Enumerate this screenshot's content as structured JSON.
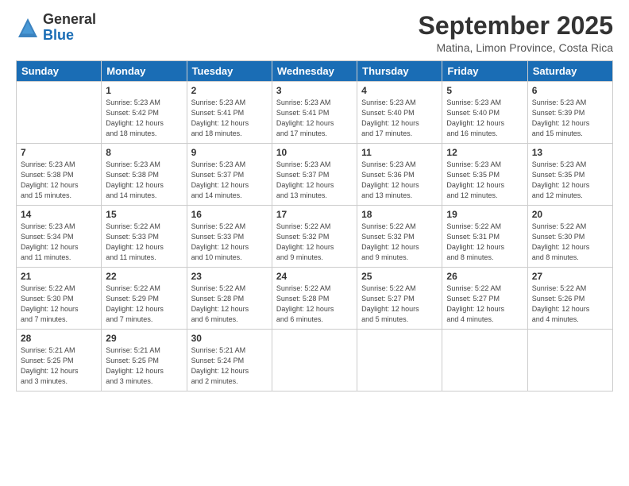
{
  "header": {
    "logo_general": "General",
    "logo_blue": "Blue",
    "month": "September 2025",
    "location": "Matina, Limon Province, Costa Rica"
  },
  "weekdays": [
    "Sunday",
    "Monday",
    "Tuesday",
    "Wednesday",
    "Thursday",
    "Friday",
    "Saturday"
  ],
  "weeks": [
    [
      {
        "day": "",
        "info": ""
      },
      {
        "day": "1",
        "info": "Sunrise: 5:23 AM\nSunset: 5:42 PM\nDaylight: 12 hours\nand 18 minutes."
      },
      {
        "day": "2",
        "info": "Sunrise: 5:23 AM\nSunset: 5:41 PM\nDaylight: 12 hours\nand 18 minutes."
      },
      {
        "day": "3",
        "info": "Sunrise: 5:23 AM\nSunset: 5:41 PM\nDaylight: 12 hours\nand 17 minutes."
      },
      {
        "day": "4",
        "info": "Sunrise: 5:23 AM\nSunset: 5:40 PM\nDaylight: 12 hours\nand 17 minutes."
      },
      {
        "day": "5",
        "info": "Sunrise: 5:23 AM\nSunset: 5:40 PM\nDaylight: 12 hours\nand 16 minutes."
      },
      {
        "day": "6",
        "info": "Sunrise: 5:23 AM\nSunset: 5:39 PM\nDaylight: 12 hours\nand 15 minutes."
      }
    ],
    [
      {
        "day": "7",
        "info": "Sunrise: 5:23 AM\nSunset: 5:38 PM\nDaylight: 12 hours\nand 15 minutes."
      },
      {
        "day": "8",
        "info": "Sunrise: 5:23 AM\nSunset: 5:38 PM\nDaylight: 12 hours\nand 14 minutes."
      },
      {
        "day": "9",
        "info": "Sunrise: 5:23 AM\nSunset: 5:37 PM\nDaylight: 12 hours\nand 14 minutes."
      },
      {
        "day": "10",
        "info": "Sunrise: 5:23 AM\nSunset: 5:37 PM\nDaylight: 12 hours\nand 13 minutes."
      },
      {
        "day": "11",
        "info": "Sunrise: 5:23 AM\nSunset: 5:36 PM\nDaylight: 12 hours\nand 13 minutes."
      },
      {
        "day": "12",
        "info": "Sunrise: 5:23 AM\nSunset: 5:35 PM\nDaylight: 12 hours\nand 12 minutes."
      },
      {
        "day": "13",
        "info": "Sunrise: 5:23 AM\nSunset: 5:35 PM\nDaylight: 12 hours\nand 12 minutes."
      }
    ],
    [
      {
        "day": "14",
        "info": "Sunrise: 5:23 AM\nSunset: 5:34 PM\nDaylight: 12 hours\nand 11 minutes."
      },
      {
        "day": "15",
        "info": "Sunrise: 5:22 AM\nSunset: 5:33 PM\nDaylight: 12 hours\nand 11 minutes."
      },
      {
        "day": "16",
        "info": "Sunrise: 5:22 AM\nSunset: 5:33 PM\nDaylight: 12 hours\nand 10 minutes."
      },
      {
        "day": "17",
        "info": "Sunrise: 5:22 AM\nSunset: 5:32 PM\nDaylight: 12 hours\nand 9 minutes."
      },
      {
        "day": "18",
        "info": "Sunrise: 5:22 AM\nSunset: 5:32 PM\nDaylight: 12 hours\nand 9 minutes."
      },
      {
        "day": "19",
        "info": "Sunrise: 5:22 AM\nSunset: 5:31 PM\nDaylight: 12 hours\nand 8 minutes."
      },
      {
        "day": "20",
        "info": "Sunrise: 5:22 AM\nSunset: 5:30 PM\nDaylight: 12 hours\nand 8 minutes."
      }
    ],
    [
      {
        "day": "21",
        "info": "Sunrise: 5:22 AM\nSunset: 5:30 PM\nDaylight: 12 hours\nand 7 minutes."
      },
      {
        "day": "22",
        "info": "Sunrise: 5:22 AM\nSunset: 5:29 PM\nDaylight: 12 hours\nand 7 minutes."
      },
      {
        "day": "23",
        "info": "Sunrise: 5:22 AM\nSunset: 5:28 PM\nDaylight: 12 hours\nand 6 minutes."
      },
      {
        "day": "24",
        "info": "Sunrise: 5:22 AM\nSunset: 5:28 PM\nDaylight: 12 hours\nand 6 minutes."
      },
      {
        "day": "25",
        "info": "Sunrise: 5:22 AM\nSunset: 5:27 PM\nDaylight: 12 hours\nand 5 minutes."
      },
      {
        "day": "26",
        "info": "Sunrise: 5:22 AM\nSunset: 5:27 PM\nDaylight: 12 hours\nand 4 minutes."
      },
      {
        "day": "27",
        "info": "Sunrise: 5:22 AM\nSunset: 5:26 PM\nDaylight: 12 hours\nand 4 minutes."
      }
    ],
    [
      {
        "day": "28",
        "info": "Sunrise: 5:21 AM\nSunset: 5:25 PM\nDaylight: 12 hours\nand 3 minutes."
      },
      {
        "day": "29",
        "info": "Sunrise: 5:21 AM\nSunset: 5:25 PM\nDaylight: 12 hours\nand 3 minutes."
      },
      {
        "day": "30",
        "info": "Sunrise: 5:21 AM\nSunset: 5:24 PM\nDaylight: 12 hours\nand 2 minutes."
      },
      {
        "day": "",
        "info": ""
      },
      {
        "day": "",
        "info": ""
      },
      {
        "day": "",
        "info": ""
      },
      {
        "day": "",
        "info": ""
      }
    ]
  ]
}
